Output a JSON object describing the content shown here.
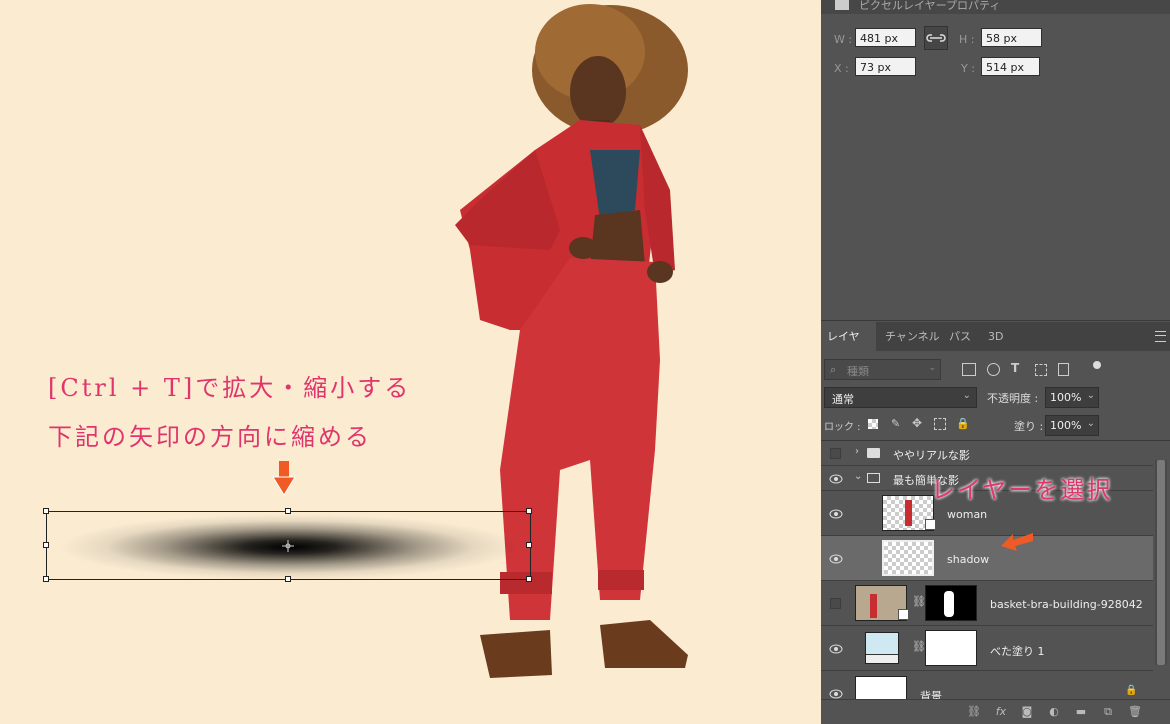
{
  "canvas": {
    "annotation_line1": "[Ctrl + T]で拡大・縮小する",
    "annotation_line2": "下記の矢印の方向に縮める"
  },
  "properties": {
    "title": "ピクセルレイヤープロパティ",
    "w_label": "W :",
    "w_value": "481 px",
    "h_label": "H :",
    "h_value": "58 px",
    "x_label": "X :",
    "x_value": "73 px",
    "y_label": "Y :",
    "y_value": "514 px"
  },
  "tabs": [
    "レイヤー",
    "チャンネル",
    "パス",
    "3D"
  ],
  "filter": {
    "placeholder": "種類"
  },
  "blend": {
    "mode": "通常",
    "opacity_label": "不透明度 :",
    "opacity": "100%",
    "fill_label": "塗り :",
    "fill": "100%",
    "lock_label": "ロック :"
  },
  "layers": [
    {
      "name": "ややリアルな影",
      "type": "group",
      "visible": false,
      "expanded": false
    },
    {
      "name": "最も簡単な影",
      "type": "group",
      "visible": true,
      "expanded": true
    },
    {
      "name": "woman",
      "type": "smart",
      "visible": true
    },
    {
      "name": "shadow",
      "type": "pixel",
      "visible": true,
      "selected": true
    },
    {
      "name": "basket-bra-building-928042",
      "type": "masked",
      "visible": false
    },
    {
      "name": "べた塗り 1",
      "type": "fill",
      "visible": true
    },
    {
      "name": "背景",
      "type": "background",
      "visible": true,
      "locked": true
    }
  ],
  "callout": "レイヤーを選択",
  "colors": {
    "accent_pink": "#e0356c",
    "arrow_orange": "#f05a24",
    "panel_bg": "#535353",
    "canvas_bg": "#faebd1"
  }
}
